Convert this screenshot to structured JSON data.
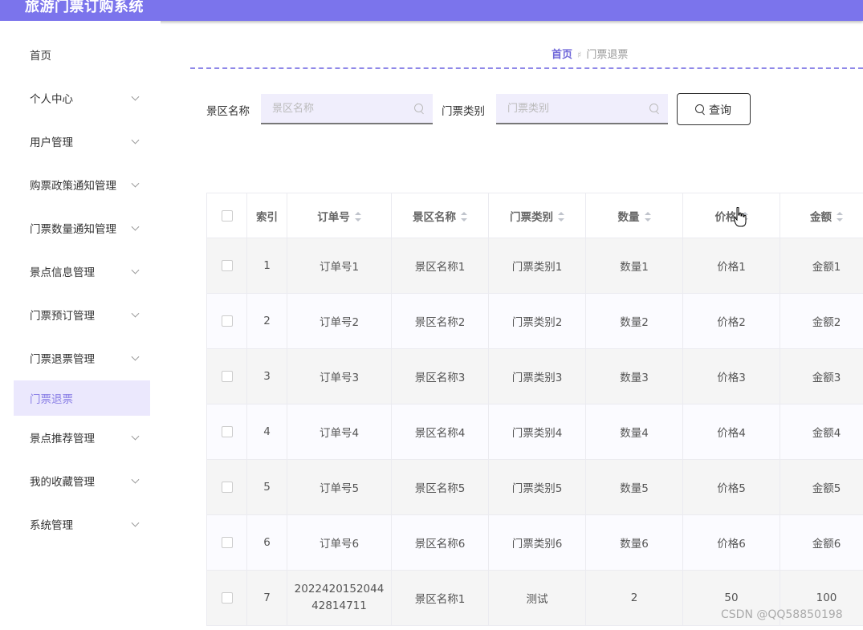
{
  "app": {
    "title": "旅游门票订购系统"
  },
  "sidebar": {
    "items": [
      {
        "label": "首页",
        "chevron": false
      },
      {
        "label": "个人中心",
        "chevron": true
      },
      {
        "label": "用户管理",
        "chevron": true
      },
      {
        "label": "购票政策通知管理",
        "chevron": true
      },
      {
        "label": "门票数量通知管理",
        "chevron": true
      },
      {
        "label": "景点信息管理",
        "chevron": true
      },
      {
        "label": "门票预订管理",
        "chevron": true
      },
      {
        "label": "门票退票管理",
        "chevron": true
      },
      {
        "label": "门票退票",
        "chevron": false,
        "active": true
      },
      {
        "label": "景点推荐管理",
        "chevron": true
      },
      {
        "label": "我的收藏管理",
        "chevron": true
      },
      {
        "label": "系统管理",
        "chevron": true
      }
    ]
  },
  "breadcrumb": {
    "home": "首页",
    "current": "门票退票"
  },
  "search": {
    "scenic_label": "景区名称",
    "scenic_placeholder": "景区名称",
    "category_label": "门票类别",
    "category_placeholder": "门票类别",
    "query_button": "查询"
  },
  "table": {
    "headers": {
      "index": "索引",
      "order_no": "订单号",
      "scenic": "景区名称",
      "category": "门票类别",
      "quantity": "数量",
      "price": "价格",
      "amount": "金额"
    },
    "rows": [
      {
        "index": "1",
        "order_no_1": "订单号1",
        "order_no_2": "",
        "scenic": "景区名称1",
        "category": "门票类别1",
        "quantity": "数量1",
        "price": "价格1",
        "amount": "金额1"
      },
      {
        "index": "2",
        "order_no_1": "订单号2",
        "order_no_2": "",
        "scenic": "景区名称2",
        "category": "门票类别2",
        "quantity": "数量2",
        "price": "价格2",
        "amount": "金额2"
      },
      {
        "index": "3",
        "order_no_1": "订单号3",
        "order_no_2": "",
        "scenic": "景区名称3",
        "category": "门票类别3",
        "quantity": "数量3",
        "price": "价格3",
        "amount": "金额3"
      },
      {
        "index": "4",
        "order_no_1": "订单号4",
        "order_no_2": "",
        "scenic": "景区名称4",
        "category": "门票类别4",
        "quantity": "数量4",
        "price": "价格4",
        "amount": "金额4"
      },
      {
        "index": "5",
        "order_no_1": "订单号5",
        "order_no_2": "",
        "scenic": "景区名称5",
        "category": "门票类别5",
        "quantity": "数量5",
        "price": "价格5",
        "amount": "金额5"
      },
      {
        "index": "6",
        "order_no_1": "订单号6",
        "order_no_2": "",
        "scenic": "景区名称6",
        "category": "门票类别6",
        "quantity": "数量6",
        "price": "价格6",
        "amount": "金额6"
      },
      {
        "index": "7",
        "order_no_1": "2022420152044",
        "order_no_2": "42814711",
        "scenic": "景区名称1",
        "category": "测试",
        "quantity": "2",
        "price": "50",
        "amount": "100"
      }
    ]
  },
  "watermark": "CSDN @QQ58850198",
  "colors": {
    "header": "#7b74ec",
    "accent": "#6f67d9",
    "active_bg": "#ebe8fd"
  }
}
